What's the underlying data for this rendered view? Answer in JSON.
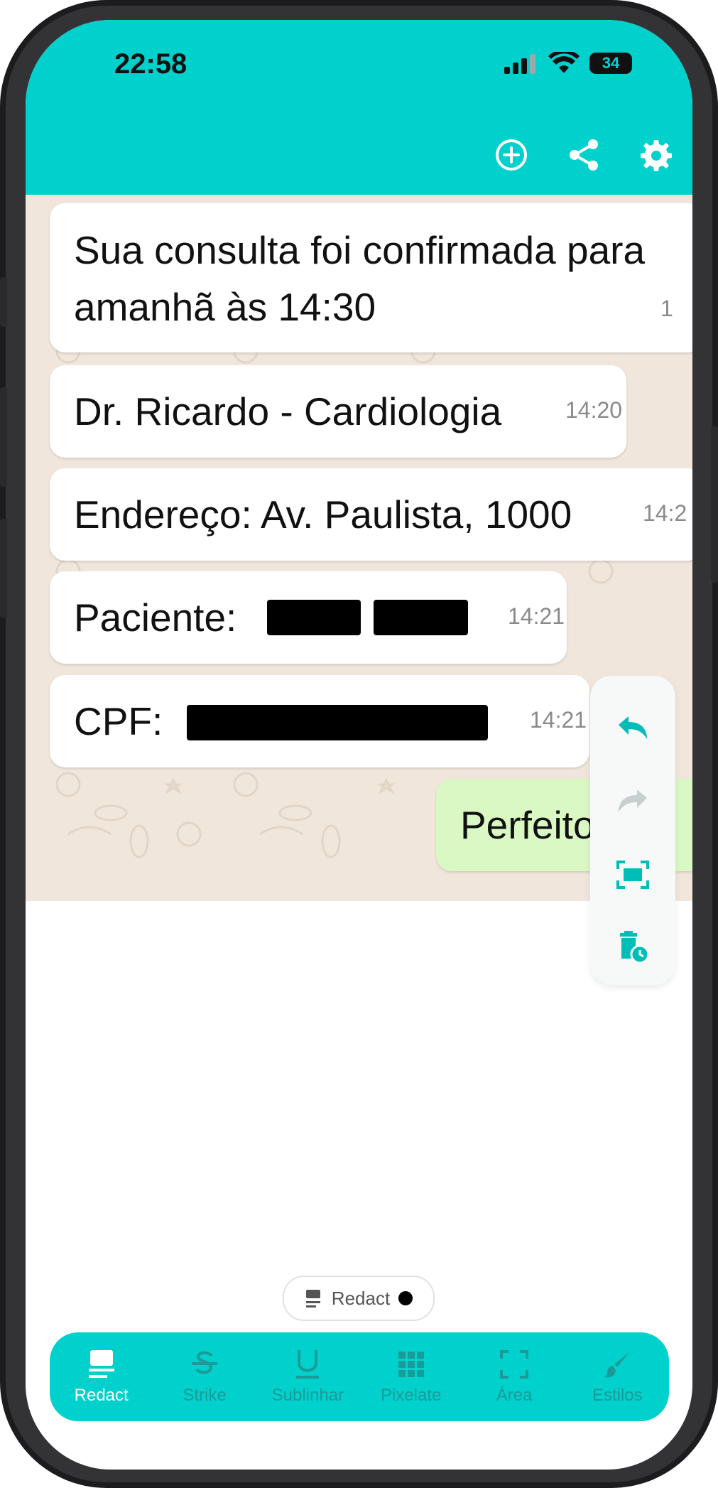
{
  "status": {
    "time": "22:58",
    "battery": "34"
  },
  "messages": [
    {
      "text": "Sua consulta foi confirmada para\namanhã às 14:30",
      "time": "1"
    },
    {
      "text": "Dr. Ricardo - Cardiologia",
      "time": "14:20"
    },
    {
      "text": "Endereço: Av. Paulista, 1000",
      "time": "14:2"
    },
    {
      "text": "Paciente:",
      "time": "14:21"
    },
    {
      "text": "CPF:",
      "time": "14:21"
    },
    {
      "text": "Perfeito, obr",
      "time": ""
    }
  ],
  "chip": {
    "label": "Redact"
  },
  "toolbar": {
    "items": [
      {
        "label": "Redact",
        "icon": "redact-icon"
      },
      {
        "label": "Strike",
        "icon": "strike-icon"
      },
      {
        "label": "Sublinhar",
        "icon": "underline-icon"
      },
      {
        "label": "Pixelate",
        "icon": "pixelate-icon"
      },
      {
        "label": "Área",
        "icon": "area-icon"
      },
      {
        "label": "Estilos",
        "icon": "brush-icon"
      }
    ]
  },
  "colors": {
    "accent": "#00D1CC",
    "chat_bg": "#F0E6DC",
    "bubble_out": "#D9F8C4"
  }
}
